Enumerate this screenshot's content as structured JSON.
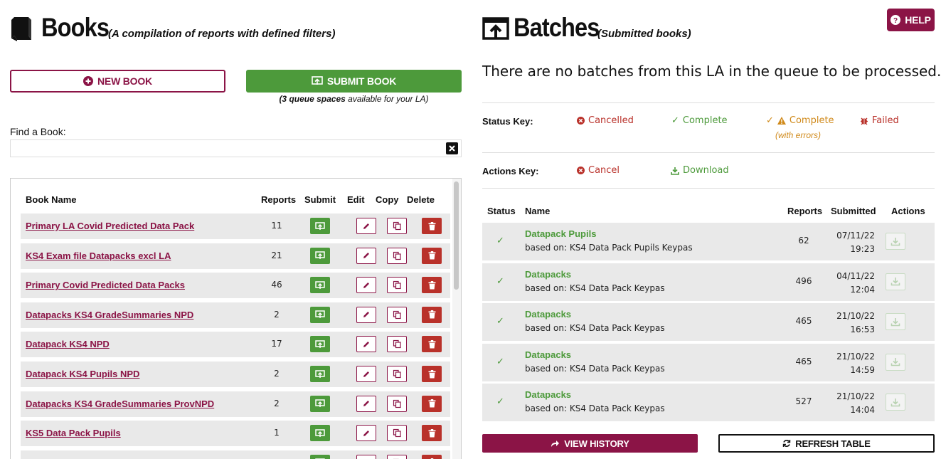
{
  "books": {
    "title": "Books",
    "subtitle": "(A compilation of reports with defined filters)",
    "new_book_label": "NEW BOOK",
    "submit_book_label": "SUBMIT BOOK",
    "queue_note_bold": "(3 queue spaces",
    "queue_note_rest": " available for your LA)",
    "find_label": "Find a Book:",
    "find_value": "",
    "columns": {
      "name": "Book Name",
      "reports": "Reports",
      "submit": "Submit",
      "edit": "Edit",
      "copy": "Copy",
      "delete": "Delete"
    },
    "rows": [
      {
        "name": "Primary LA Covid Predicted Data Pack",
        "reports": "11"
      },
      {
        "name": "KS4 Exam file Datapacks excl LA",
        "reports": "21"
      },
      {
        "name": "Primary Covid Predicted Data Packs",
        "reports": "46"
      },
      {
        "name": "Datapacks KS4 GradeSummaries NPD",
        "reports": "2"
      },
      {
        "name": "Datapack KS4 NPD",
        "reports": "17"
      },
      {
        "name": "Datapack KS4 Pupils NPD",
        "reports": "2"
      },
      {
        "name": "Datapacks KS4 GradeSummaries ProvNPD",
        "reports": "2"
      },
      {
        "name": "KS5 Data Pack Pupils",
        "reports": "1"
      },
      {
        "name": "",
        "reports": ""
      }
    ]
  },
  "batches": {
    "title": "Batches",
    "subtitle": "(Submitted books)",
    "help_label": "HELP",
    "empty_message": "There are no batches from this LA in the queue to be processed.",
    "status_key_label": "Status Key:",
    "status_keys": {
      "cancelled": "Cancelled",
      "complete": "Complete",
      "complete_errors": "Complete",
      "complete_errors_note": "(with errors)",
      "failed": "Failed"
    },
    "actions_key_label": "Actions Key:",
    "action_keys": {
      "cancel": "Cancel",
      "download": "Download"
    },
    "columns": {
      "status": "Status",
      "name": "Name",
      "reports": "Reports",
      "submitted": "Submitted",
      "actions": "Actions"
    },
    "rows": [
      {
        "name": "Datapack Pupils",
        "based_on": "based on: KS4 Data Pack Pupils Keypas",
        "reports": "62",
        "date": "07/11/22",
        "time": "19:23"
      },
      {
        "name": "Datapacks",
        "based_on": "based on: KS4 Data Pack Keypas",
        "reports": "496",
        "date": "04/11/22",
        "time": "12:04"
      },
      {
        "name": "Datapacks",
        "based_on": "based on: KS4 Data Pack Keypas",
        "reports": "465",
        "date": "21/10/22",
        "time": "16:53"
      },
      {
        "name": "Datapacks",
        "based_on": "based on: KS4 Data Pack Keypas",
        "reports": "465",
        "date": "21/10/22",
        "time": "14:59"
      },
      {
        "name": "Datapacks",
        "based_on": "based on: KS4 Data Pack Keypas",
        "reports": "527",
        "date": "21/10/22",
        "time": "14:04"
      }
    ],
    "view_history_label": "VIEW HISTORY",
    "refresh_label": "REFRESH TABLE"
  },
  "colors": {
    "maroon": "#8b1446",
    "green": "#4d9a3b",
    "red": "#b9312a",
    "orange": "#d08a1b"
  }
}
